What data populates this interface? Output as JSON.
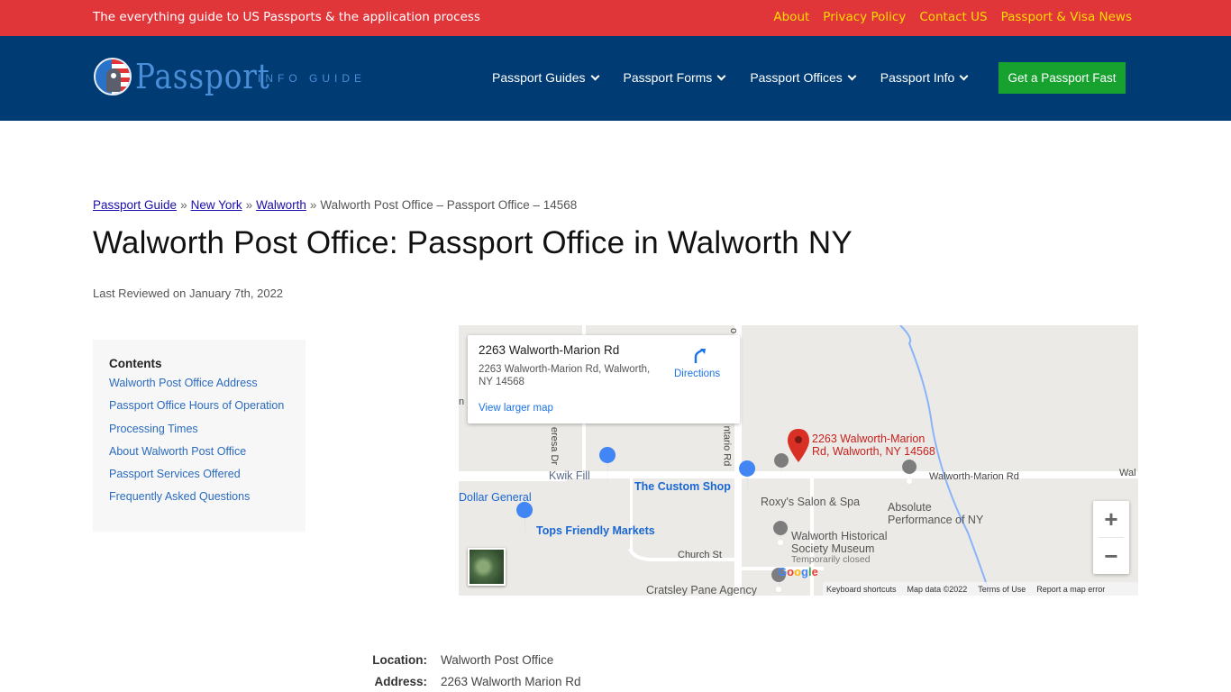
{
  "topbar": {
    "tagline": "The everything guide to US Passports & the application process",
    "links": [
      "About",
      "Privacy Policy",
      "Contact US",
      "Passport & Visa News"
    ]
  },
  "header": {
    "logo_word": "Passport",
    "logo_sub": "INFO GUIDE",
    "nav": [
      "Passport Guides",
      "Passport Forms",
      "Passport Offices",
      "Passport Info"
    ],
    "cta": "Get a Passport Fast"
  },
  "breadcrumb": {
    "items": [
      "Passport Guide",
      "New York",
      "Walworth"
    ],
    "current": "Walworth Post Office – Passport Office – 14568",
    "separator": "»"
  },
  "page": {
    "title": "Walworth Post Office: Passport Office in Walworth NY",
    "reviewed": "Last Reviewed on January 7th, 2022"
  },
  "contents": {
    "heading": "Contents",
    "items": [
      "Walworth Post Office Address",
      "Passport Office Hours of Operation",
      "Processing Times",
      "About Walworth Post Office",
      "Passport Services Offered",
      "Frequently Asked Questions"
    ]
  },
  "map": {
    "card_title": "2263 Walworth-Marion Rd",
    "card_address": "2263 Walworth-Marion Rd, Walworth, NY 14568",
    "directions": "Directions",
    "larger_map": "View larger map",
    "pin_label_1": "2263 Walworth-Marion",
    "pin_label_2": "Rd, Walworth, NY 14568",
    "labels": {
      "kwik_fill": "Kwik Fill",
      "custom_shop": "The Custom Shop",
      "roxys": "Roxy's Salon & Spa",
      "dollar_general": "Dollar General",
      "tops": "Tops Friendly Markets",
      "absolute_1": "Absolute",
      "absolute_2": "Performance of NY",
      "museum_1": "Walworth Historical",
      "museum_2": "Society Museum",
      "museum_closed": "Temporarily closed",
      "cratsley": "Cratsley Pane Agency",
      "walworth_marion_rd": "Walworth-Marion Rd",
      "walworth_edge": "Wal",
      "church_st": "Church St",
      "teresa_dr": "eresa Dr",
      "ontario_rd": "ntario Rd",
      "left_edge": "n",
      "top_edge": "o"
    },
    "google": "Google",
    "attribution": [
      "Keyboard shortcuts",
      "Map data ©2022",
      "Terms of Use",
      "Report a map error"
    ],
    "zoom_in": "+",
    "zoom_out": "−"
  },
  "details": {
    "rows": [
      {
        "k": "Location:",
        "v": "Walworth Post Office"
      },
      {
        "k": "Address:",
        "v": "2263 Walworth Marion Rd"
      }
    ]
  },
  "colors": {
    "topbar": "#e0363a",
    "header": "#003b73",
    "cta": "#17a22f",
    "link_yellow": "#ffdd00",
    "link_blue": "#2a6bbf",
    "map_pin": "#d93025"
  }
}
